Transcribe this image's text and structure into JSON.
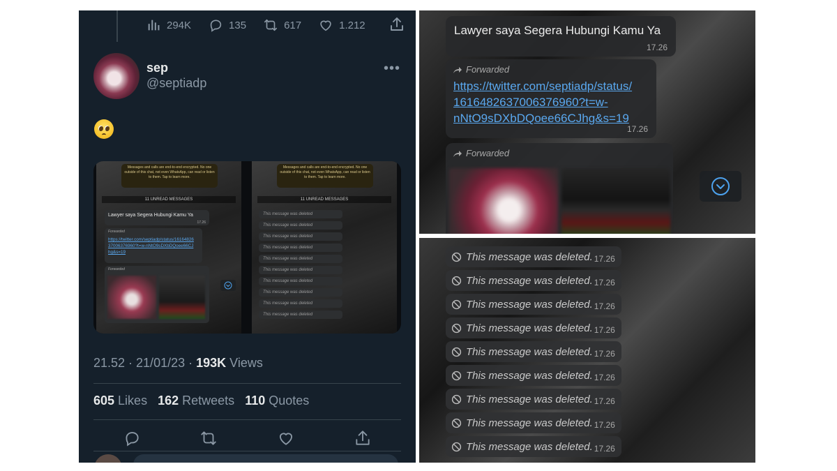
{
  "tweet": {
    "top_stats": {
      "views": "294K",
      "replies": "135",
      "retweets": "617",
      "likes": "1.212"
    },
    "author": {
      "name": "sep",
      "handle": "@septiadp"
    },
    "timestamp": "21.52 · 21/01/23 · ",
    "views_count": "193K",
    "views_label": " Views",
    "likes_count": "605",
    "likes_label": " Likes",
    "retweets_count": "162",
    "retweets_label": " Retweets",
    "quotes_count": "110",
    "quotes_label": " Quotes",
    "thumb": {
      "encryption_notice": "Messages and calls are end-to-end encrypted. No one outside of this chat, not even WhatsApp, can read or listen to them. Tap to learn more.",
      "unread": "11 UNREAD MESSAGES",
      "lawyer_msg": "Lawyer saya Segera Hubungi Kamu Ya",
      "lawyer_time": "17.26",
      "forwarded": "Forwarded",
      "link": "https://twitter.com/septiadp/status/1616482637006376960?t=w-nNtO9sDXbDQoee66CJhg&s=19",
      "deleted": "This message was deleted",
      "deleted_time": "17.26"
    }
  },
  "whatsapp_top": {
    "message_text": "Lawyer saya Segera Hubungi Kamu Ya",
    "message_time": "17.26",
    "forwarded_label": "Forwarded",
    "link_line1": "https://twitter.com/septiadp/status/",
    "link_line2": "1616482637006376960?t=w-",
    "link_line3": "nNtO9sDXbDQoee66CJhg&s=19",
    "link_time": "17.26",
    "forwarded_label_2": "Forwarded"
  },
  "whatsapp_bottom": {
    "deleted": [
      {
        "text": "This message was deleted.",
        "time": "17.26"
      },
      {
        "text": "This message was deleted.",
        "time": "17.26"
      },
      {
        "text": "This message was deleted.",
        "time": "17.26"
      },
      {
        "text": "This message was deleted.",
        "time": "17.26"
      },
      {
        "text": "This message was deleted.",
        "time": "17.26"
      },
      {
        "text": "This message was deleted.",
        "time": "17.26"
      },
      {
        "text": "This message was deleted.",
        "time": "17.26"
      },
      {
        "text": "This message was deleted.",
        "time": "17.26"
      },
      {
        "text": "This message was deleted.",
        "time": "17.26"
      }
    ]
  },
  "colors": {
    "twitter_bg": "#15202b",
    "link": "#5aa8ef",
    "muted": "#8b98a5"
  }
}
